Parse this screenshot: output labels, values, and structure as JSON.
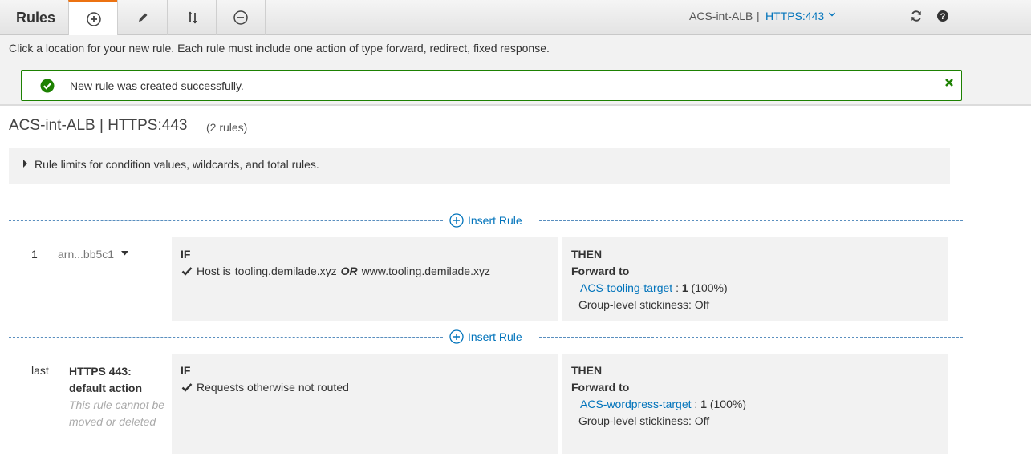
{
  "toolbar": {
    "title": "Rules",
    "buttons": [
      {
        "name": "add-rule-button",
        "icon": "plus-circle-icon"
      },
      {
        "name": "edit-rule-button",
        "icon": "pencil-icon"
      },
      {
        "name": "reorder-rules-button",
        "icon": "reorder-arrows-icon"
      },
      {
        "name": "delete-rule-button",
        "icon": "minus-circle-icon"
      }
    ],
    "load_balancer": "ACS-int-ALB",
    "separator": "|",
    "listener": "HTTPS:443",
    "refresh_icon": "refresh-icon",
    "help_icon": "help-icon"
  },
  "instruction": "Click a location for your new rule. Each rule must include one action of type forward, redirect, fixed response.",
  "flash": {
    "message": "New rule was created successfully.",
    "status_color": "#1d8102"
  },
  "header": {
    "title": "ACS-int-ALB | HTTPS:443",
    "rule_count": "(2 rules)"
  },
  "limits": {
    "text": "Rule limits for condition values, wildcards, and total rules."
  },
  "insert_rule_label": "Insert Rule",
  "rules": [
    {
      "number": "1",
      "arn": "arn...bb5c1",
      "if_label": "IF",
      "condition": {
        "prefix": "Host is",
        "value1": "tooling.demilade.xyz",
        "operator": "OR",
        "value2": "www.tooling.demilade.xyz"
      },
      "then_label": "THEN",
      "action": "Forward to",
      "target": "ACS-tooling-target",
      "weight": "1",
      "percent": "(100%)",
      "stickiness": "Group-level stickiness: Off"
    },
    {
      "number": "last",
      "default_title_line1": "HTTPS 443:",
      "default_title_line2": "default action",
      "default_note": "This rule cannot be moved or deleted",
      "if_label": "IF",
      "condition_text": "Requests otherwise not routed",
      "then_label": "THEN",
      "action": "Forward to",
      "target": "ACS-wordpress-target",
      "weight": "1",
      "percent": "(100%)",
      "stickiness": "Group-level stickiness: Off"
    }
  ],
  "colors": {
    "link": "#0073bb",
    "accent": "#ec7211",
    "success": "#1d8102"
  }
}
